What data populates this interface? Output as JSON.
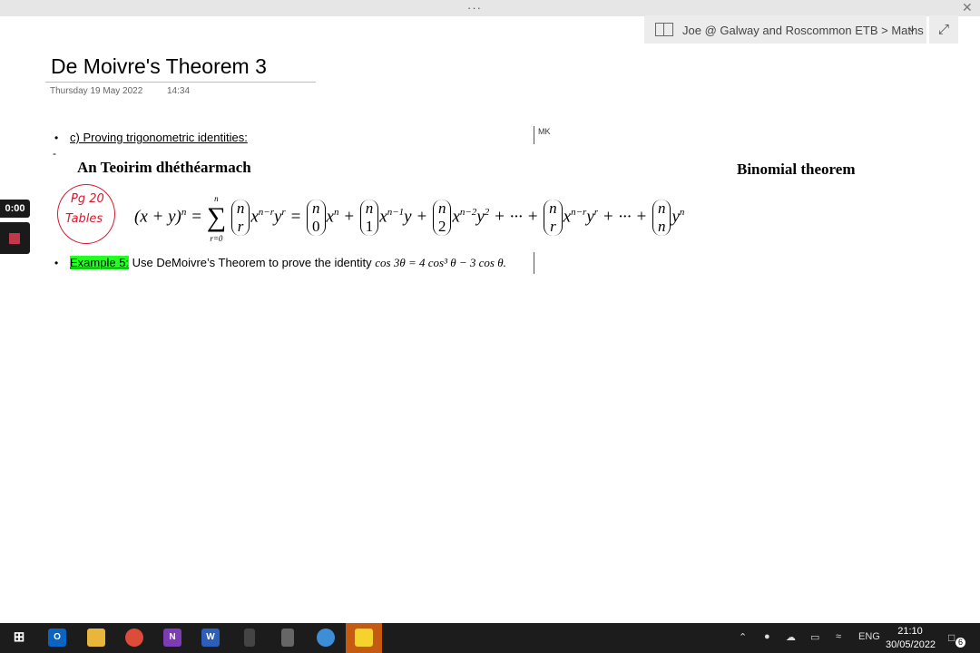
{
  "window": {
    "dots": "···",
    "close": "✕"
  },
  "notebook": {
    "path": "Joe @ Galway and Roscommon ETB > Maths"
  },
  "page": {
    "title": "De Moivre's Theorem 3",
    "date": "Thursday 19 May 2022",
    "time": "14:34"
  },
  "content": {
    "bullet": "•",
    "section_heading": "c) Proving trigonometric identities:",
    "dash": "-",
    "author_tag": "MK",
    "irish_heading": "An Teoirim dhéthéarmach",
    "english_heading": "Binomial theorem",
    "handwritten_note": {
      "line1": "Pg 20",
      "line2": "Tables"
    },
    "example_label": "Example 5:",
    "example_text": " Use DeMoivre’s Theorem to prove the identity ",
    "example_math": "cos 3θ = 4 cos³ θ − 3 cos θ."
  },
  "recorder": {
    "time": "0:00"
  },
  "taskbar": {
    "apps": [
      "windows-start",
      "outlook",
      "file-explorer",
      "chrome",
      "onenote",
      "word",
      "calculator-1",
      "calculator-2",
      "remote-desktop",
      "sticky-notes"
    ],
    "language": "ENG",
    "clock_time": "21:10",
    "clock_date": "30/05/2022",
    "notifications": "6"
  },
  "colors": {
    "highlight": "#22ff22",
    "ink_red": "#d9182c",
    "active_app": "#c55a11"
  }
}
